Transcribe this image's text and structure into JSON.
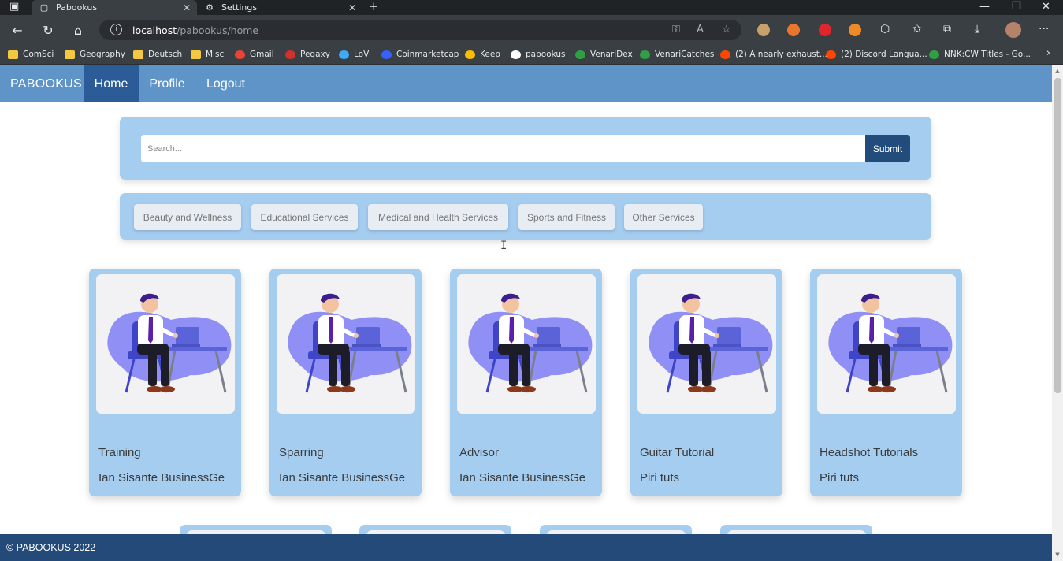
{
  "browser": {
    "tabs": [
      {
        "title": "Pabookus",
        "icon": "page-icon"
      },
      {
        "title": "Settings",
        "icon": "gear-icon"
      }
    ],
    "url_host": "localhost",
    "url_path": "/pabookus/home",
    "bookmarks": [
      {
        "label": "ComSci",
        "icon": "folder-icon",
        "color": "#f5c842"
      },
      {
        "label": "Geography",
        "icon": "folder-icon",
        "color": "#f5c842"
      },
      {
        "label": "Deutsch",
        "icon": "folder-icon",
        "color": "#f5c842"
      },
      {
        "label": "Misc",
        "icon": "folder-icon",
        "color": "#f5c842"
      },
      {
        "label": "Gmail",
        "icon": "gmail-icon",
        "color": "#ea4335"
      },
      {
        "label": "Pegaxy",
        "icon": "pegaxy-icon",
        "color": "#d0312d"
      },
      {
        "label": "LoV",
        "icon": "globe-icon",
        "color": "#3fa9f5"
      },
      {
        "label": "Coinmarketcap",
        "icon": "coinmarketcap-icon",
        "color": "#3861fb"
      },
      {
        "label": "Keep",
        "icon": "keep-icon",
        "color": "#fbbc04"
      },
      {
        "label": "pabookus",
        "icon": "github-icon",
        "color": "#ffffff"
      },
      {
        "label": "VenariDex",
        "icon": "plus-icon",
        "color": "#2ea043"
      },
      {
        "label": "VenariCatches",
        "icon": "plus-icon",
        "color": "#2ea043"
      },
      {
        "label": "(2) A nearly exhaust...",
        "icon": "reddit-icon",
        "color": "#ff4500"
      },
      {
        "label": "(2) Discord Langua...",
        "icon": "reddit-icon",
        "color": "#ff4500"
      },
      {
        "label": "NNK:CW Titles - Go...",
        "icon": "plus-icon",
        "color": "#2ea043"
      }
    ]
  },
  "navbar": {
    "brand": "PABOOKUS",
    "links": [
      "Home",
      "Profile",
      "Logout"
    ],
    "active": "Home",
    "color": "#5e94c8",
    "active_color": "#2c5c97"
  },
  "search": {
    "placeholder": "Search...",
    "submit_label": "Submit"
  },
  "categories": [
    "Beauty and Wellness",
    "Educational Services",
    "Medical and Health Services",
    "Sports and Fitness",
    "Other Services"
  ],
  "services": [
    {
      "title": "Training",
      "owner": "Ian Sisante BusinessGe"
    },
    {
      "title": "Sparring",
      "owner": "Ian Sisante BusinessGe"
    },
    {
      "title": "Advisor",
      "owner": "Ian Sisante BusinessGe"
    },
    {
      "title": "Guitar Tutorial",
      "owner": "Piri tuts"
    },
    {
      "title": "Headshot Tutorials",
      "owner": "Piri tuts"
    }
  ],
  "footer": {
    "text": "© PABOOKUS 2022",
    "color": "#234a78"
  }
}
